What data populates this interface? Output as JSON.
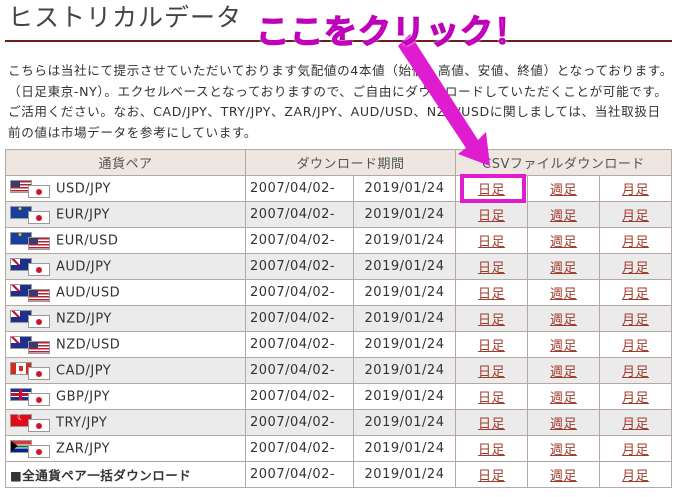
{
  "header": {
    "title": "ヒストリカルデータ"
  },
  "intro_text": "こちらは当社にて提示させていただいております気配値の4本値（始値、高値、安値、終値）となっております。（日足東京-NY）。エクセルベースとなっておりますので、ご自由にダウンロードしていただくことが可能です。ご活用ください。なお、CAD/JPY、TRY/JPY、ZAR/JPY、AUD/USD、NZD/USDに関しましては、当社取扱日前の値は市場データを参考にしています。",
  "annotation": {
    "callout": "ここをクリック！",
    "color": "#e01cd0"
  },
  "table": {
    "headers": {
      "pair": "通貨ペア",
      "period": "ダウンロード期間",
      "csv": "CSVファイルダウンロード"
    },
    "rows": [
      {
        "flags": [
          "us",
          "jp"
        ],
        "pair": "USD/JPY",
        "from": "2007/04/02-",
        "to": "2019/01/24",
        "daily": "日足",
        "weekly": "週足",
        "monthly": "月足"
      },
      {
        "flags": [
          "eu",
          "jp"
        ],
        "pair": "EUR/JPY",
        "from": "2007/04/02-",
        "to": "2019/01/24",
        "daily": "日足",
        "weekly": "週足",
        "monthly": "月足"
      },
      {
        "flags": [
          "eu",
          "us"
        ],
        "pair": "EUR/USD",
        "from": "2007/04/02-",
        "to": "2019/01/24",
        "daily": "日足",
        "weekly": "週足",
        "monthly": "月足"
      },
      {
        "flags": [
          "au",
          "jp"
        ],
        "pair": "AUD/JPY",
        "from": "2007/04/02-",
        "to": "2019/01/24",
        "daily": "日足",
        "weekly": "週足",
        "monthly": "月足"
      },
      {
        "flags": [
          "au",
          "us"
        ],
        "pair": "AUD/USD",
        "from": "2007/04/02-",
        "to": "2019/01/24",
        "daily": "日足",
        "weekly": "週足",
        "monthly": "月足"
      },
      {
        "flags": [
          "nz",
          "jp"
        ],
        "pair": "NZD/JPY",
        "from": "2007/04/02-",
        "to": "2019/01/24",
        "daily": "日足",
        "weekly": "週足",
        "monthly": "月足"
      },
      {
        "flags": [
          "nz",
          "us"
        ],
        "pair": "NZD/USD",
        "from": "2007/04/02-",
        "to": "2019/01/24",
        "daily": "日足",
        "weekly": "週足",
        "monthly": "月足"
      },
      {
        "flags": [
          "ca",
          "jp"
        ],
        "pair": "CAD/JPY",
        "from": "2007/04/02-",
        "to": "2019/01/24",
        "daily": "日足",
        "weekly": "週足",
        "monthly": "月足"
      },
      {
        "flags": [
          "gb",
          "jp"
        ],
        "pair": "GBP/JPY",
        "from": "2007/04/02-",
        "to": "2019/01/24",
        "daily": "日足",
        "weekly": "週足",
        "monthly": "月足"
      },
      {
        "flags": [
          "tr",
          "jp"
        ],
        "pair": "TRY/JPY",
        "from": "2007/04/02-",
        "to": "2019/01/24",
        "daily": "日足",
        "weekly": "週足",
        "monthly": "月足"
      },
      {
        "flags": [
          "za",
          "jp"
        ],
        "pair": "ZAR/JPY",
        "from": "2007/04/02-",
        "to": "2019/01/24",
        "daily": "日足",
        "weekly": "週足",
        "monthly": "月足"
      }
    ],
    "all_row": {
      "label": "■全通貨ペア一括ダウンロード",
      "from": "2007/04/02-",
      "to": "2019/01/24",
      "daily": "日足",
      "weekly": "週足",
      "monthly": "月足"
    }
  }
}
